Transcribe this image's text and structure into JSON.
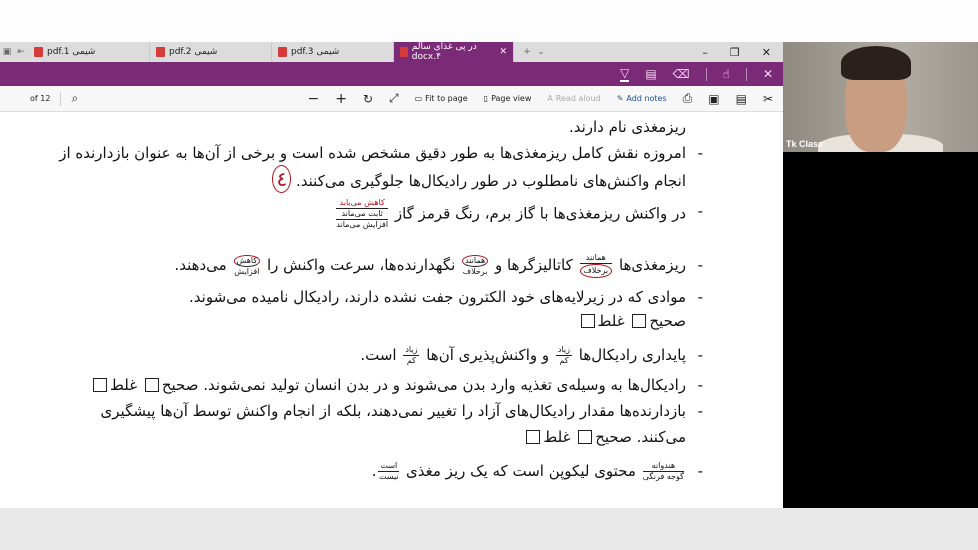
{
  "tabs": [
    {
      "label": "pdf.1 شیمی"
    },
    {
      "label": "pdf.2 شیمی"
    },
    {
      "label": "pdf.3 شیمی"
    },
    {
      "label": "در پی غذای سالم docx.۴",
      "active": true
    }
  ],
  "window_controls": {
    "minimize": "–",
    "maximize": "❐",
    "close": "✕"
  },
  "ink_tools": {
    "pen": "▽",
    "highlighter": "▤",
    "eraser": "⌫",
    "touch": "☝",
    "close": "✕"
  },
  "toolbar": {
    "page_of": "of 12",
    "fit_to_page": "Fit to page",
    "page_view": "Page view",
    "read_aloud": "Read aloud",
    "add_notes": "Add notes"
  },
  "doc": {
    "l0": "ریزمغذی نام دارند.",
    "l1": "امروزه نقش کامل ریزمغذی‌ها به طور دقیق مشخص شده است و برخی از آن‌ها به عنوان بازدارنده از",
    "l2": "انجام واکنش‌های نامطلوب در طور رادیکال‌ها جلوگیری می‌کنند.",
    "l2_note": "٤",
    "l3": "در واکنش ریزمغذی‌ها با گاز برم، رنگ قرمز گاز",
    "l3_opts": [
      "کاهش می‌یابد",
      "ثابت می‌ماند",
      "افزایش می‌ماند"
    ],
    "l4a": "ریزمغذی‌ها",
    "l4b": "کاتالیزگرها و",
    "l4c": "نگهدارنده‌ها، سرعت واکنش را",
    "l4d": "می‌دهند.",
    "l4_opt1": [
      "همانند",
      "برخلاف"
    ],
    "l4_opt2": [
      "همانند",
      "برخلاف"
    ],
    "l4_opt3": [
      "کاهش",
      "افزایش"
    ],
    "l5": "موادی که در زیرلایه‌های خود الکترون جفت نشده دارند، رادیکال نامیده می‌شوند.",
    "true_label": "صحیح",
    "false_label": "غلط",
    "l6a": "پایداری رادیکال‌ها",
    "l6b": "و واکنش‌پذیری آن‌ها",
    "l6c": "است.",
    "l6_opts": [
      "زیاد",
      "کم"
    ],
    "l7": "رادیکال‌ها به وسیله‌ی تغذیه وارد بدن می‌شوند و در بدن انسان تولید نمی‌شوند.",
    "l8": "بازدارنده‌ها مقدار رادیکال‌های آزاد را تغییر نمی‌دهند، بلکه از انجام واکنش توسط آن‌ها پیشگیری",
    "l9": "می‌کنند.",
    "l10a": "محتوی لیکوپن است که یک ریز مغذی",
    "l10_opt1": [
      "هندوانه",
      "گوجه فرنگی"
    ],
    "l10_opt2": [
      "است",
      "نیست"
    ],
    "bullet": "-"
  },
  "webcam": {
    "label": "Tk Class"
  }
}
